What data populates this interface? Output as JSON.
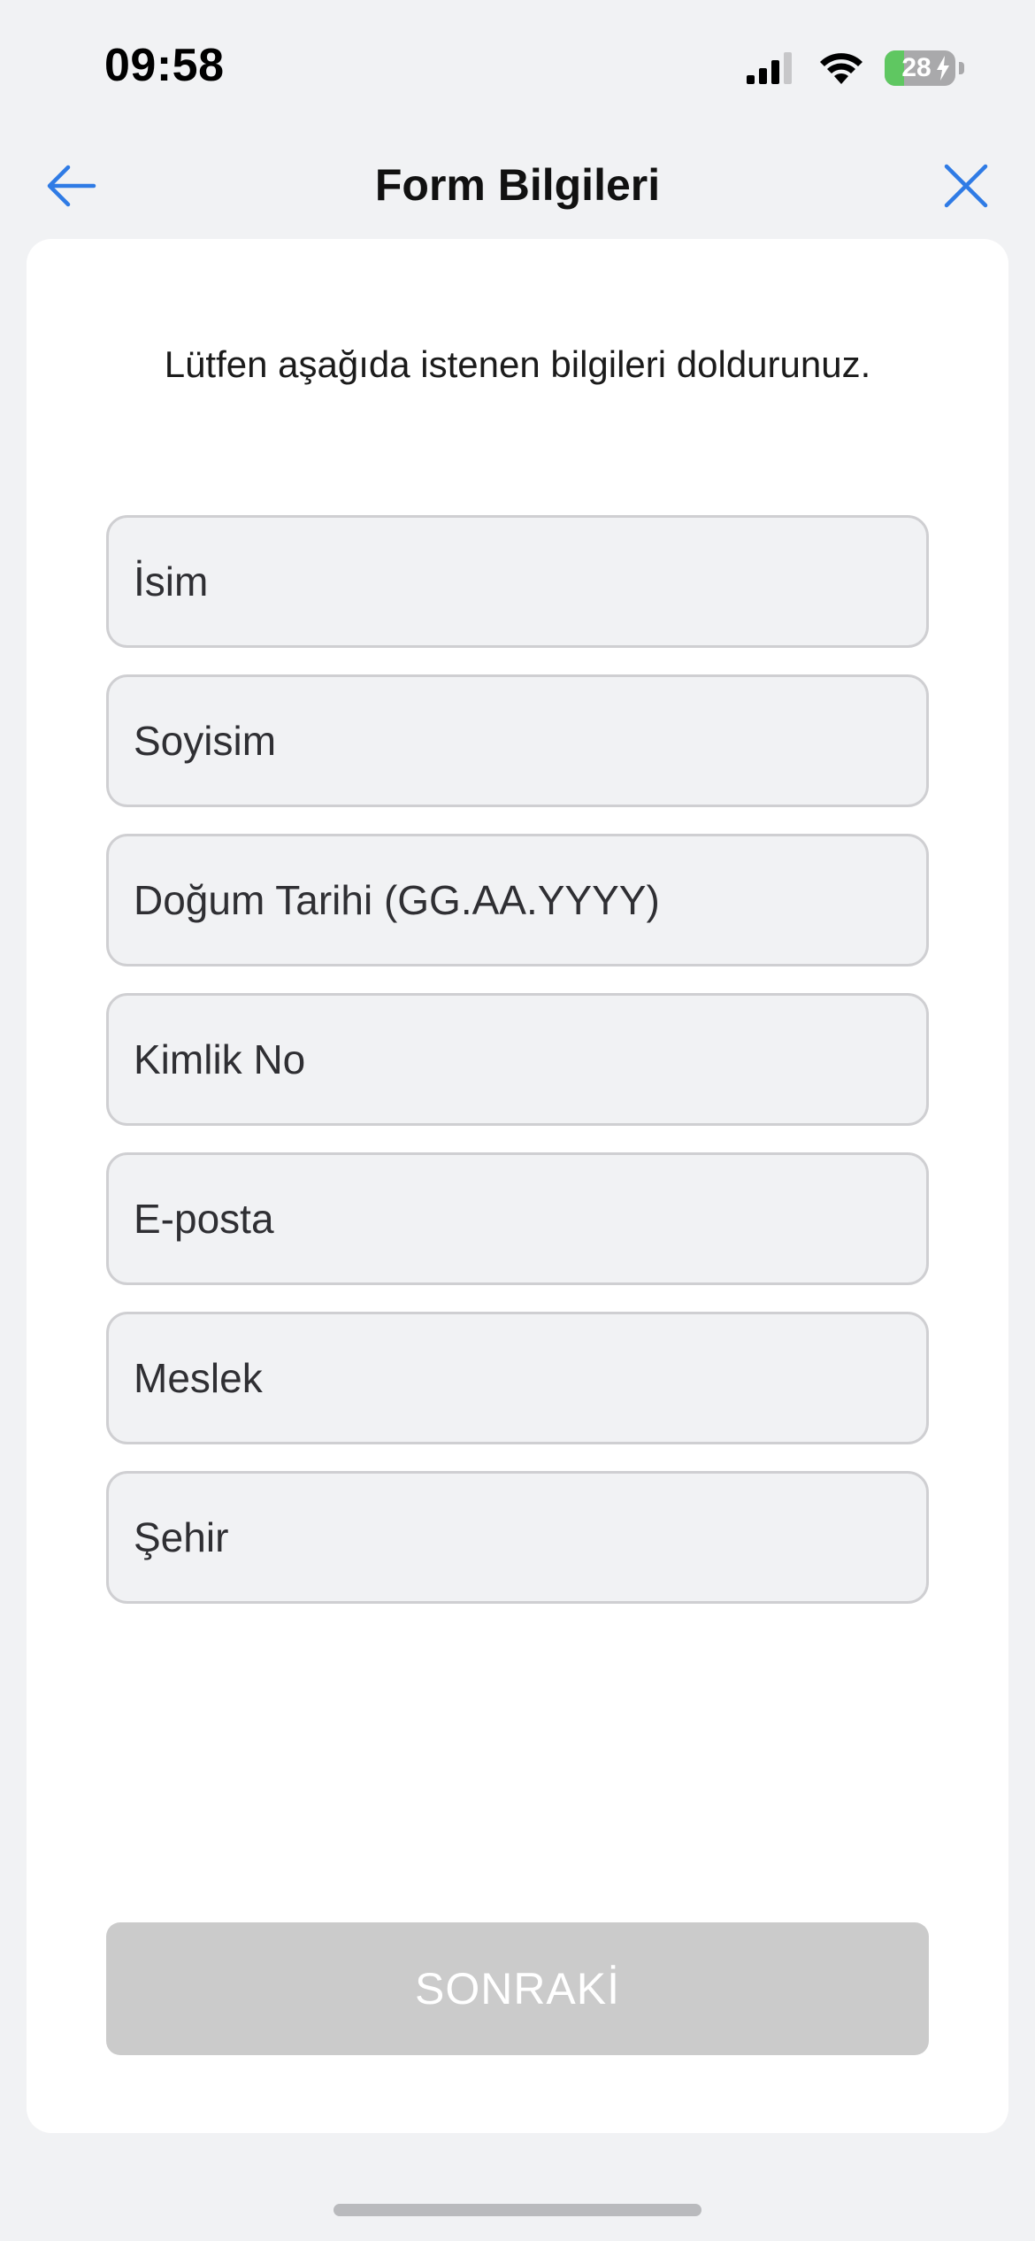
{
  "status_bar": {
    "time": "09:58",
    "battery_level": "28",
    "icons": [
      "signal-icon",
      "wifi-icon",
      "battery-charging-icon"
    ]
  },
  "nav": {
    "title": "Form Bilgileri",
    "back_icon": "arrow-left-icon",
    "close_icon": "close-icon",
    "accent_color": "#2f7be5"
  },
  "form": {
    "intro": "Lütfen aşağıda istenen bilgileri doldurunuz.",
    "fields": [
      {
        "placeholder": "İsim",
        "value": ""
      },
      {
        "placeholder": "Soyisim",
        "value": ""
      },
      {
        "placeholder": "Doğum Tarihi (GG.AA.YYYY)",
        "value": ""
      },
      {
        "placeholder": "Kimlik No",
        "value": ""
      },
      {
        "placeholder": "E-posta",
        "value": ""
      },
      {
        "placeholder": "Meslek",
        "value": ""
      },
      {
        "placeholder": "Şehir",
        "value": ""
      }
    ],
    "next_label": "SONRAKİ",
    "next_enabled": false
  }
}
